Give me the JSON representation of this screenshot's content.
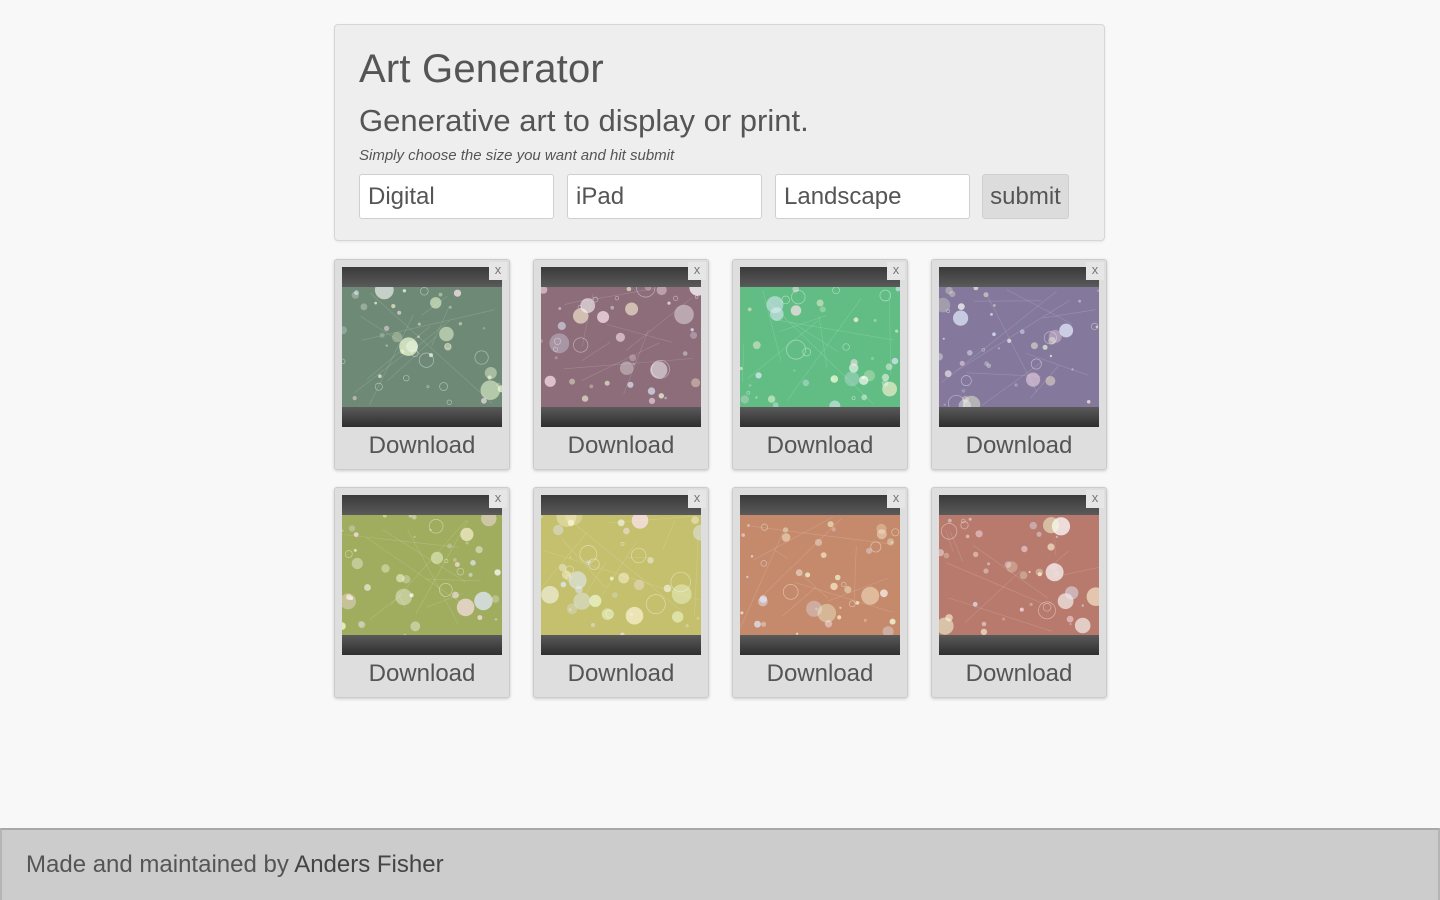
{
  "header": {
    "title": "Art Generator",
    "subtitle": "Generative art to display or print.",
    "hint": "Simply choose the size you want and hit submit"
  },
  "form": {
    "medium": "Digital",
    "device": "iPad",
    "orientation": "Landscape",
    "submit_label": "submit"
  },
  "gallery": {
    "close_label": "x",
    "download_label": "Download",
    "items": [
      {
        "color": "#6e8a76"
      },
      {
        "color": "#8d6d7a"
      },
      {
        "color": "#62bd84"
      },
      {
        "color": "#84799c"
      },
      {
        "color": "#a0ad5e"
      },
      {
        "color": "#c4c06e"
      },
      {
        "color": "#c58a6c"
      },
      {
        "color": "#b87a6d"
      }
    ]
  },
  "footer": {
    "text": "Made and maintained by",
    "author": "Anders Fisher"
  }
}
